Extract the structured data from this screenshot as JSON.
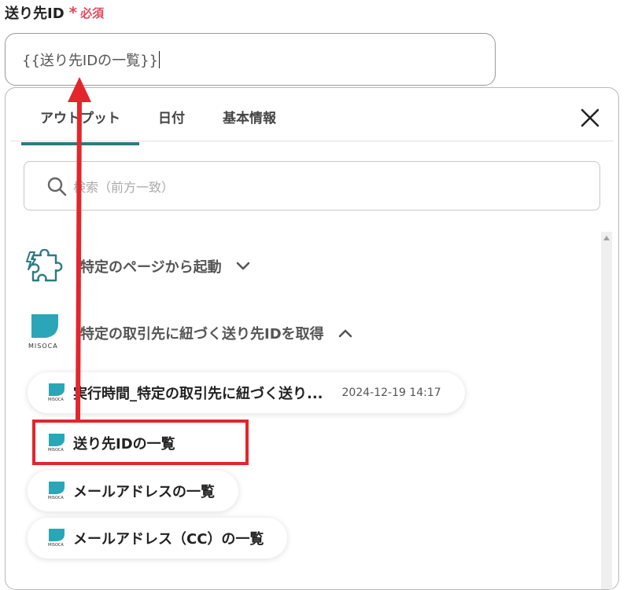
{
  "field": {
    "label": "送り先ID",
    "required_star": "*",
    "required_text": "必須",
    "value": "{{送り先IDの一覧}}"
  },
  "tabs": [
    {
      "label": "アウトプット",
      "active": true
    },
    {
      "label": "日付",
      "active": false
    },
    {
      "label": "基本情報",
      "active": false
    }
  ],
  "search": {
    "placeholder": "検索（前方一致）"
  },
  "groups": [
    {
      "label": "特定のページから起動",
      "icon": "puzzle-lightning-icon",
      "expanded": false
    },
    {
      "label": "特定の取引先に紐づく送り先IDを取得",
      "icon": "misoca-logo",
      "icon_caption": "MISOCA",
      "expanded": true
    }
  ],
  "items": [
    {
      "label": "実行時間_特定の取引先に紐づく送り...",
      "time": "2024-12-19 14:17"
    },
    {
      "label": "送り先IDの一覧",
      "highlighted": true
    },
    {
      "label": "メールアドレスの一覧"
    },
    {
      "label": "メールアドレス（CC）の一覧"
    }
  ],
  "colors": {
    "accent": "#2a7b83",
    "required": "#e0495e",
    "misoca": "#2aa6b8",
    "annotation": "#e3252c"
  }
}
